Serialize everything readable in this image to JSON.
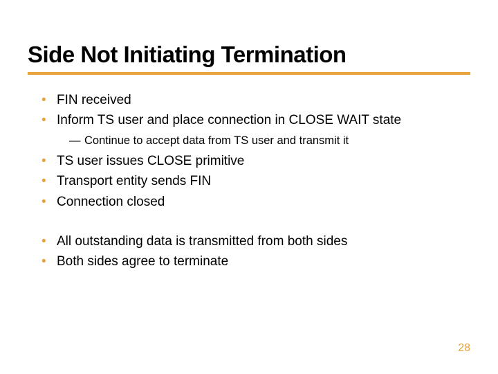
{
  "title": "Side Not Initiating Termination",
  "bullets_a": [
    "FIN received",
    "Inform TS user and place connection in CLOSE WAIT state"
  ],
  "sub_a": [
    "Continue to accept data from TS user and transmit it"
  ],
  "bullets_b": [
    "TS user issues CLOSE primitive",
    "Transport entity sends FIN",
    "Connection closed"
  ],
  "bullets_c": [
    "All outstanding data is transmitted from both sides",
    "Both sides agree to terminate"
  ],
  "page_number": "28"
}
